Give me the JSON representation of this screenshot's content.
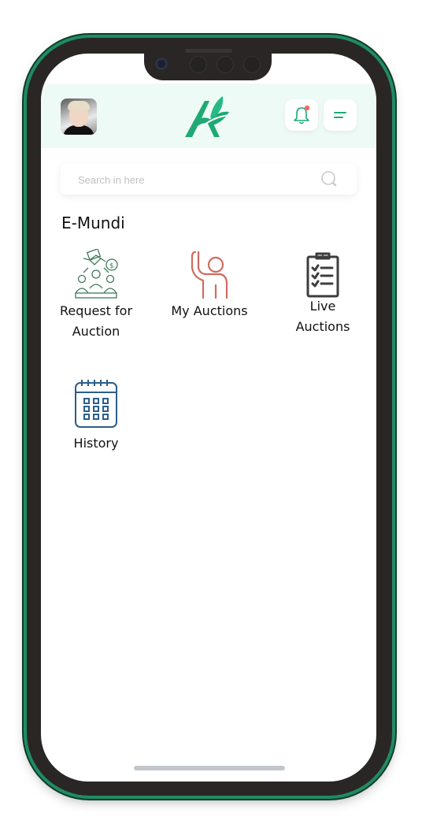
{
  "app": {
    "name": "E-Mundi",
    "brand_color": "#1fa974",
    "notification_dot_color": "#f06b5e"
  },
  "header": {
    "avatar": "user-avatar",
    "logo": "leaf-a-logo",
    "notification_icon": "bell-icon",
    "menu_icon": "menu-icon"
  },
  "search": {
    "placeholder": "Search in here",
    "value": "",
    "icon": "search-icon"
  },
  "section": {
    "title": "E-Mundi"
  },
  "tiles": [
    {
      "label_line1": "Request for",
      "label_line2": "Auction",
      "icon": "team-handshake-money-icon",
      "color": "#3f7a5b"
    },
    {
      "label_line1": "My Auctions",
      "icon": "raised-hand-person-icon",
      "color": "#d06b5f"
    },
    {
      "label_line1": "Live",
      "label_line2": "Auctions",
      "icon": "clipboard-checklist-icon",
      "color": "#3d3d3d"
    },
    {
      "label_line1": "History",
      "icon": "calendar-icon",
      "color": "#2a5d8a"
    }
  ]
}
